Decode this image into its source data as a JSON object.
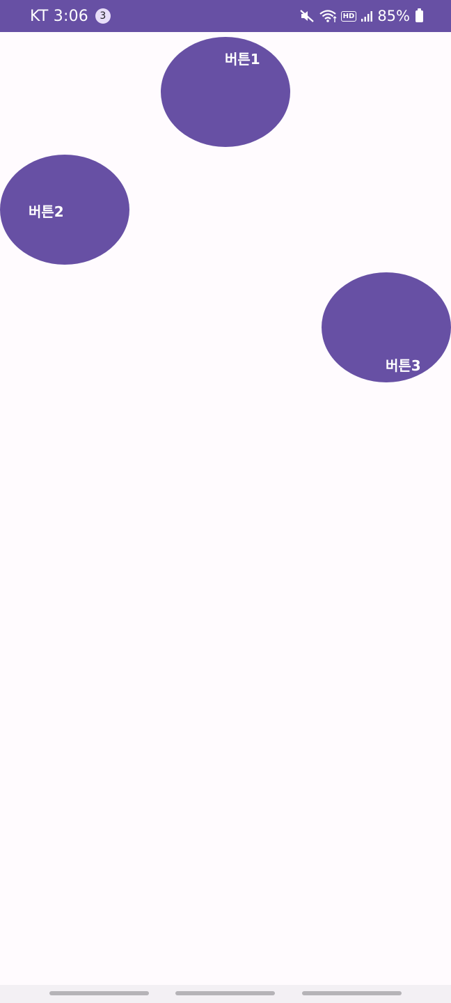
{
  "status_bar": {
    "carrier": "KT",
    "time": "3:06",
    "notification_count": "3",
    "hd_label": "HD",
    "battery_percent": "85%",
    "icons": [
      "mute-icon",
      "wifi-icon",
      "hd-voice-icon",
      "signal-icon",
      "battery-icon"
    ]
  },
  "buttons": {
    "button1_label": "버튼1",
    "button2_label": "버튼2",
    "button3_label": "버튼3"
  },
  "colors": {
    "primary": "#6750a4",
    "background": "#fffbfe",
    "nav_bar": "#f3f0f4",
    "nav_pill": "#b5b3b7"
  }
}
